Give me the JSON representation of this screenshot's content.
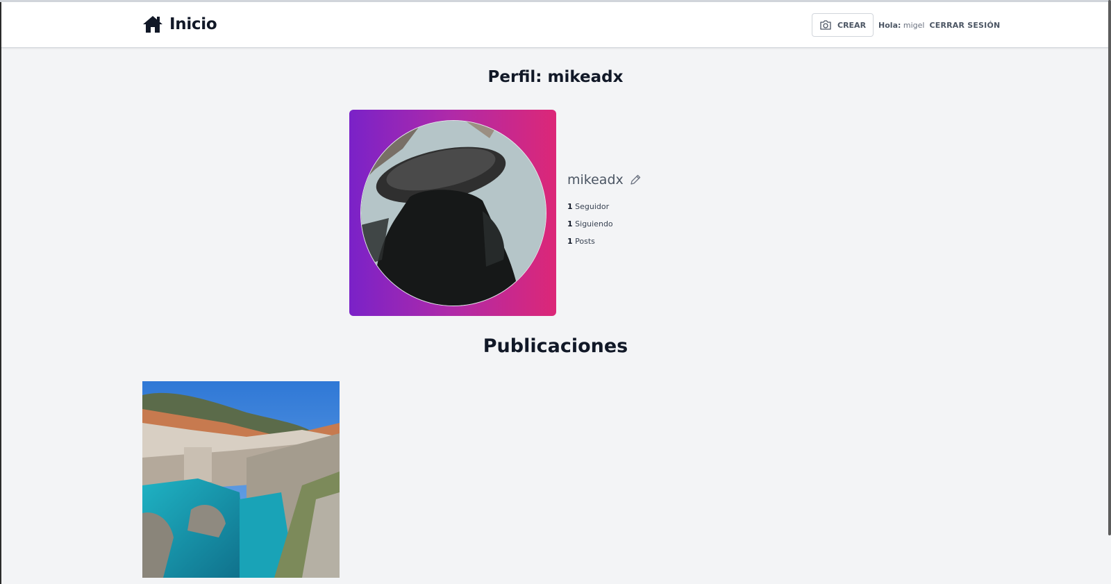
{
  "header": {
    "brand_label": "Inicio",
    "brand_icon": "home-icon",
    "create_label": "CREAR",
    "create_icon": "camera-icon",
    "greeting_label": "Hola:",
    "greeting_user": "migel",
    "logout_label": "CERRAR SESIÓN"
  },
  "profile": {
    "title": "Perfil: mikeadx",
    "username": "mikeadx",
    "edit_icon": "pencil-icon",
    "gradient_colors": [
      "#7a22c8",
      "#dc2777"
    ],
    "stats": [
      {
        "count": "1",
        "label": "Seguidor"
      },
      {
        "count": "1",
        "label": "Siguiendo"
      },
      {
        "count": "1",
        "label": "Posts"
      }
    ]
  },
  "publications": {
    "title": "Publicaciones"
  }
}
